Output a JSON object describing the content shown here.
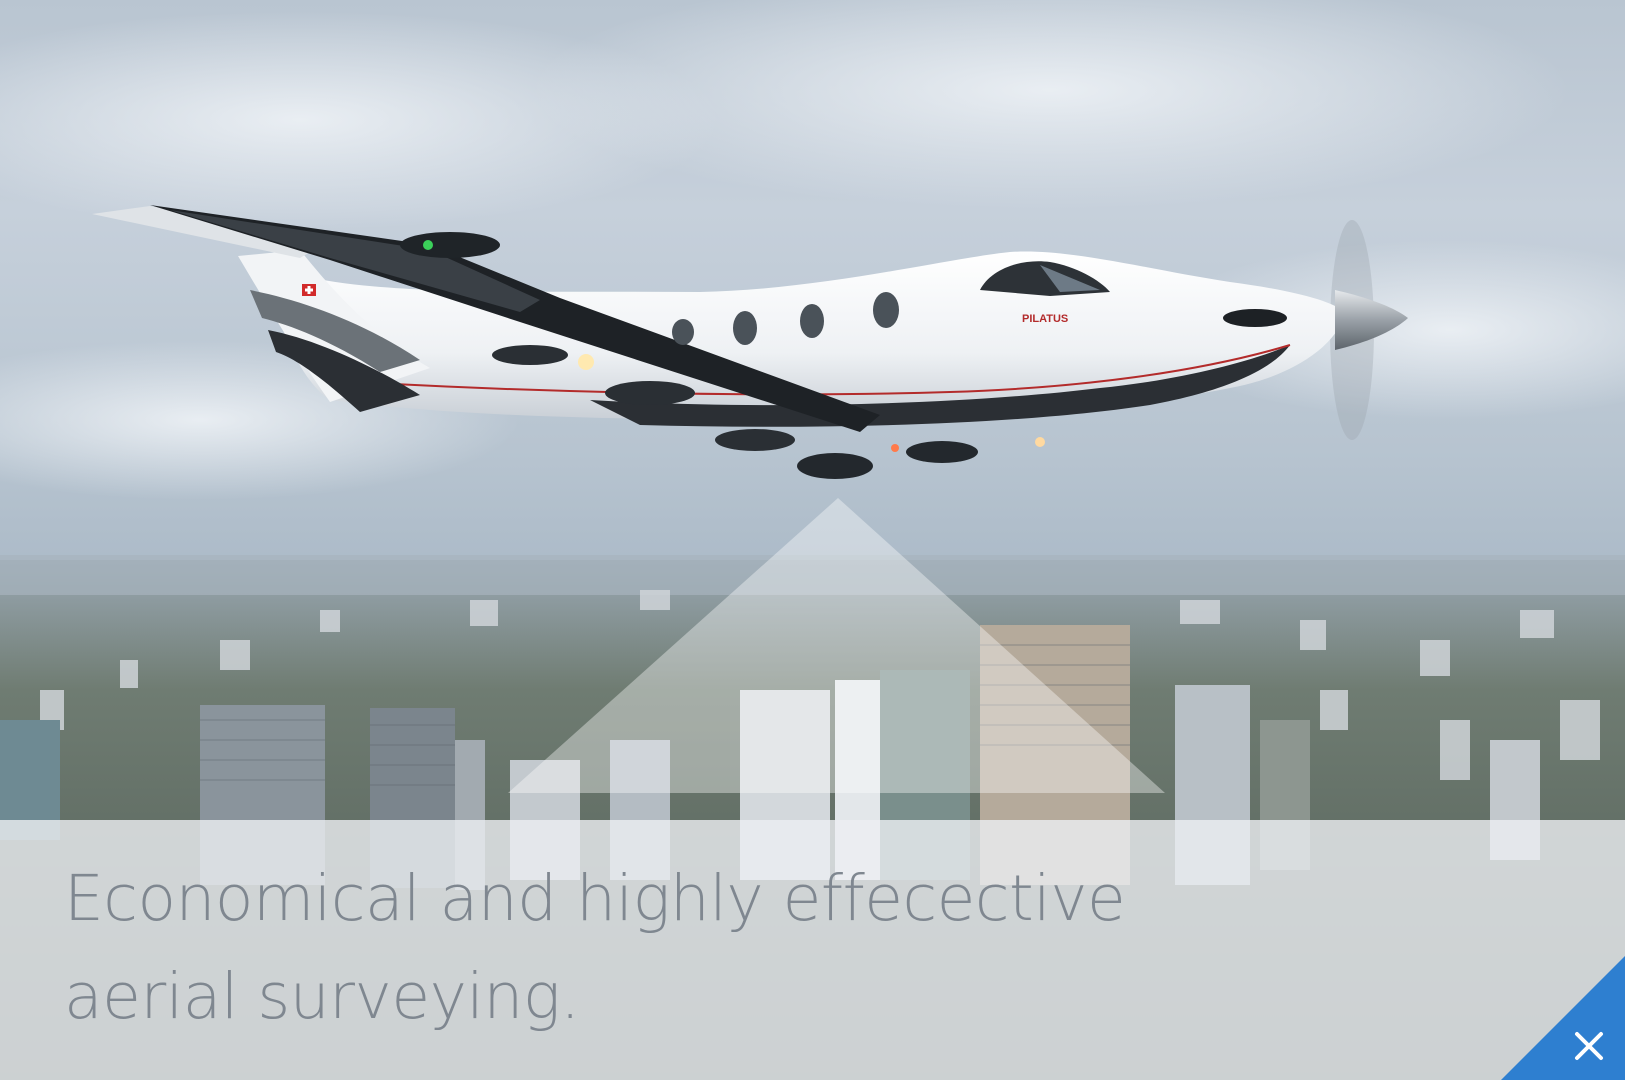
{
  "caption": {
    "line1": "Economical and highly effecective",
    "line2": "aerial surveying."
  },
  "aircraft": {
    "livery_text": "PILATUS"
  },
  "close_button": {
    "icon": "close-icon",
    "color": "#2e7fd0"
  },
  "colors": {
    "caption_text": "#7f8790",
    "accent": "#2e7fd0"
  }
}
